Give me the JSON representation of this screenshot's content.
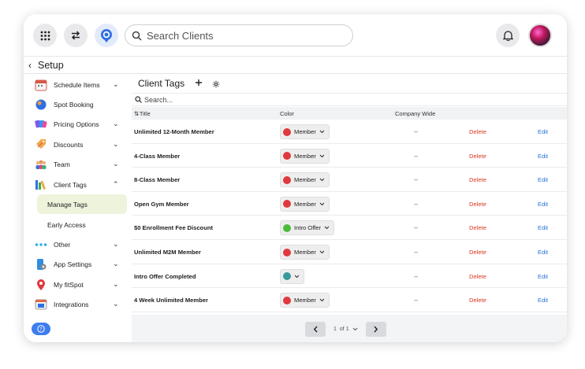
{
  "topbar": {
    "search_placeholder": "Search Clients",
    "icons": [
      "grid-icon",
      "swap-icon",
      "location-pin-icon",
      "bell-icon",
      "avatar"
    ]
  },
  "setup": {
    "title": "Setup"
  },
  "sidebar": {
    "items": [
      {
        "label": "Schedule Items",
        "icon": "calendar-icon",
        "expandable": true
      },
      {
        "label": "Spot Booking",
        "icon": "spot-icon",
        "expandable": false
      },
      {
        "label": "Pricing Options",
        "icon": "pricing-icon",
        "expandable": true
      },
      {
        "label": "Discounts",
        "icon": "discount-tag-icon",
        "expandable": true
      },
      {
        "label": "Team",
        "icon": "team-icon",
        "expandable": true
      },
      {
        "label": "Client Tags",
        "icon": "tags-icon",
        "expandable": true,
        "expanded": true
      },
      {
        "label": "Other",
        "icon": "dots-icon",
        "expandable": true
      },
      {
        "label": "App Settings",
        "icon": "app-settings-icon",
        "expandable": true
      },
      {
        "label": "My fitSpot",
        "icon": "map-pin-icon",
        "expandable": true
      },
      {
        "label": "Integrations",
        "icon": "integrations-icon",
        "expandable": true
      }
    ],
    "subitems": [
      {
        "label": "Manage Tags",
        "active": true
      },
      {
        "label": "Early Access",
        "active": false
      }
    ]
  },
  "main": {
    "title": "Client Tags",
    "filter_placeholder": "Search...",
    "columns": {
      "title": "Title",
      "color": "Color",
      "company_wide": "Company Wide"
    },
    "rows": [
      {
        "title": "Unlimited 12-Month Member",
        "color": "#e0383e",
        "color_label": "Member",
        "company_wide": "--",
        "delete": "Delete",
        "edit": "Edit"
      },
      {
        "title": "4-Class Member",
        "color": "#e0383e",
        "color_label": "Member",
        "company_wide": "--",
        "delete": "Delete",
        "edit": "Edit"
      },
      {
        "title": "8-Class Member",
        "color": "#e0383e",
        "color_label": "Member",
        "company_wide": "--",
        "delete": "Delete",
        "edit": "Edit"
      },
      {
        "title": "Open Gym Member",
        "color": "#e0383e",
        "color_label": "Member",
        "company_wide": "--",
        "delete": "Delete",
        "edit": "Edit"
      },
      {
        "title": "$0 Enrollment Fee Discount",
        "color": "#4cbb3a",
        "color_label": "Intro Offer",
        "company_wide": "--",
        "delete": "Delete",
        "edit": "Edit"
      },
      {
        "title": "Unlimited M2M Member",
        "color": "#e0383e",
        "color_label": "Member",
        "company_wide": "--",
        "delete": "Delete",
        "edit": "Edit"
      },
      {
        "title": "Intro Offer Completed",
        "color": "#3a9a9a",
        "color_label": "",
        "company_wide": "--",
        "delete": "Delete",
        "edit": "Edit"
      },
      {
        "title": "4 Week Unlimited Member",
        "color": "#e0383e",
        "color_label": "Member",
        "company_wide": "--",
        "delete": "Delete",
        "edit": "Edit"
      }
    ],
    "pagination": {
      "page": "1",
      "of": "of 1"
    }
  },
  "colors": {
    "accent": "#3d7df0",
    "delete": "#d93a1f",
    "edit": "#2a6fd6",
    "active_bg": "#eef3dc"
  }
}
